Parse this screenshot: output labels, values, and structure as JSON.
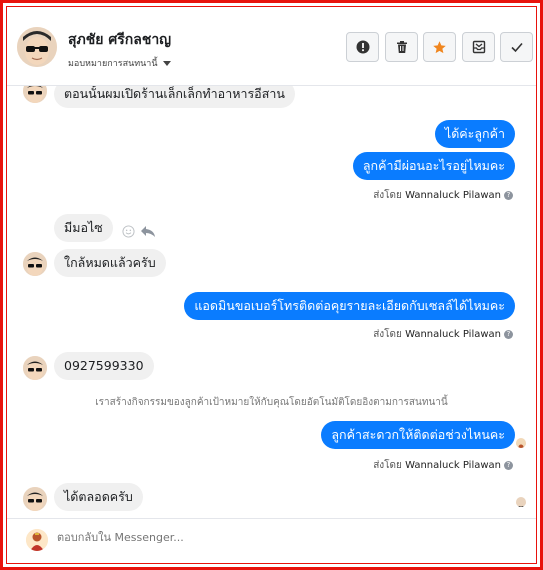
{
  "header": {
    "contact_name": "สุภชัย ศรีกลชาญ",
    "assign_label": "มอบหมายการสนทนานี้",
    "actions": [
      "alert-icon",
      "trash-icon",
      "star-icon",
      "archive-icon",
      "check-icon"
    ]
  },
  "messages": {
    "partial_top": "ตอนนั้นผมเปิดร้านเล็กเล็กทำอาหารอีสาน",
    "out1": "ได้ค่ะลูกค้า",
    "out2": "ลูกค้ามีผ่อนอะไรอยู่ไหมคะ",
    "sent_by_prefix": "ส่งโดย",
    "sent_by_name": "Wannaluck Pilawan",
    "in1": "มีมอไซ",
    "in2": "ใกล้หมดแล้วครับ",
    "out3": "แอดมินขอเบอร์โทรติดต่อคุยรายละเอียดกับเซลล์ได้ไหมคะ",
    "in3": "0927599330",
    "system_note": "เราสร้างกิจกรรมของลูกค้าเป้าหมายให้กับคุณโดยอัตโนมัติโดยอิงตามการสนทนานี้",
    "out4": "ลูกค้าสะดวกให้ติดต่อช่วงไหนคะ",
    "in4": "ได้ตลอดครับ"
  },
  "footer": {
    "reply_placeholder": "ตอบกลับใน Messenger..."
  },
  "colors": {
    "outgoing": "#0a7cff",
    "incoming": "#f0f0f0",
    "border": "#e8120c",
    "star": "#f0861f"
  }
}
